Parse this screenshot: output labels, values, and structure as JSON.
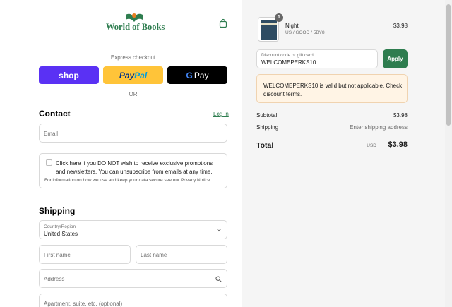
{
  "store": {
    "name": "World of Books"
  },
  "express": {
    "label": "Express checkout",
    "shop": "shop",
    "paypal_a": "Pay",
    "paypal_b": "Pal",
    "gpay_g": "G",
    "gpay_text": "Pay",
    "or": "OR"
  },
  "contact": {
    "title": "Contact",
    "login": "Log in",
    "email_placeholder": "Email",
    "consent_text": "Click here if you DO NOT wish to receive exclusive promotions and newsletters. You can unsubscribe from emails at any time.",
    "privacy_text": "For information on how we use and keep your data secure see our Privacy Notice"
  },
  "shipping": {
    "title": "Shipping",
    "country_label": "Country/Region",
    "country_value": "United States",
    "first_name_placeholder": "First name",
    "last_name_placeholder": "Last name",
    "address_placeholder": "Address",
    "apartment_placeholder": "Apartment, suite, etc. (optional)"
  },
  "cart": {
    "item": {
      "name": "Night",
      "variant": "US / GOOD / 5BY8",
      "price": "$3.98",
      "quantity": "1"
    },
    "discount_label": "Discount code or gift card",
    "discount_value": "WELCOMEPERKS10",
    "apply": "Apply",
    "notice": "WELCOMEPERKS10 is valid but not applicable. Check discount terms.",
    "subtotal_label": "Subtotal",
    "subtotal_value": "$3.98",
    "shipping_label": "Shipping",
    "shipping_value": "Enter shipping address",
    "total_label": "Total",
    "currency": "USD",
    "total_value": "$3.98"
  },
  "colors": {
    "accent": "#2e7d4f",
    "shop": "#5a31f4",
    "paypal": "#ffc439",
    "gpay": "#000000",
    "notice_bg": "#fff4e5"
  }
}
